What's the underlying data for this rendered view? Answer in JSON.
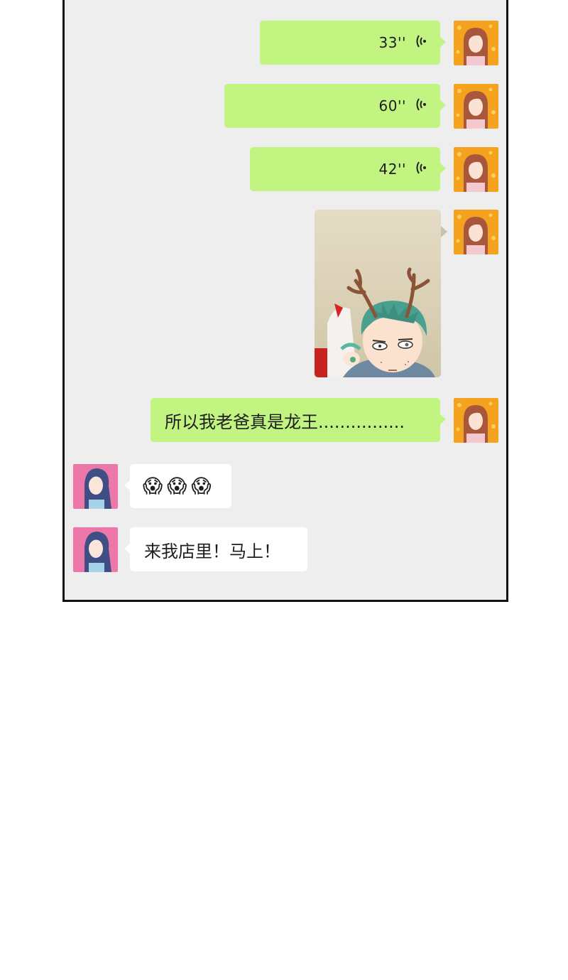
{
  "chat": {
    "messages": [
      {
        "side": "right",
        "type": "voice",
        "duration": "33''"
      },
      {
        "side": "right",
        "type": "voice",
        "duration": "60''"
      },
      {
        "side": "right",
        "type": "voice",
        "duration": "42''"
      },
      {
        "side": "right",
        "type": "image",
        "description_icon": "photo"
      },
      {
        "side": "right",
        "type": "text",
        "text": "所以我老爸真是龙王................"
      },
      {
        "side": "left",
        "type": "emoji",
        "emojis": [
          "😱",
          "😱",
          "😱"
        ]
      },
      {
        "side": "left",
        "type": "text",
        "text": "来我店里！马上！"
      }
    ]
  },
  "colors": {
    "chat_background": "#eeeeee",
    "my_bubble": "#c2f482",
    "their_bubble": "#ffffff",
    "my_avatar_bg": "#f5a21f",
    "their_avatar_bg": "#ec77a8"
  },
  "icons": {
    "voice": "voice-wave-icon",
    "my_avatar": "girl-orange-avatar",
    "their_avatar": "girl-pink-avatar"
  }
}
